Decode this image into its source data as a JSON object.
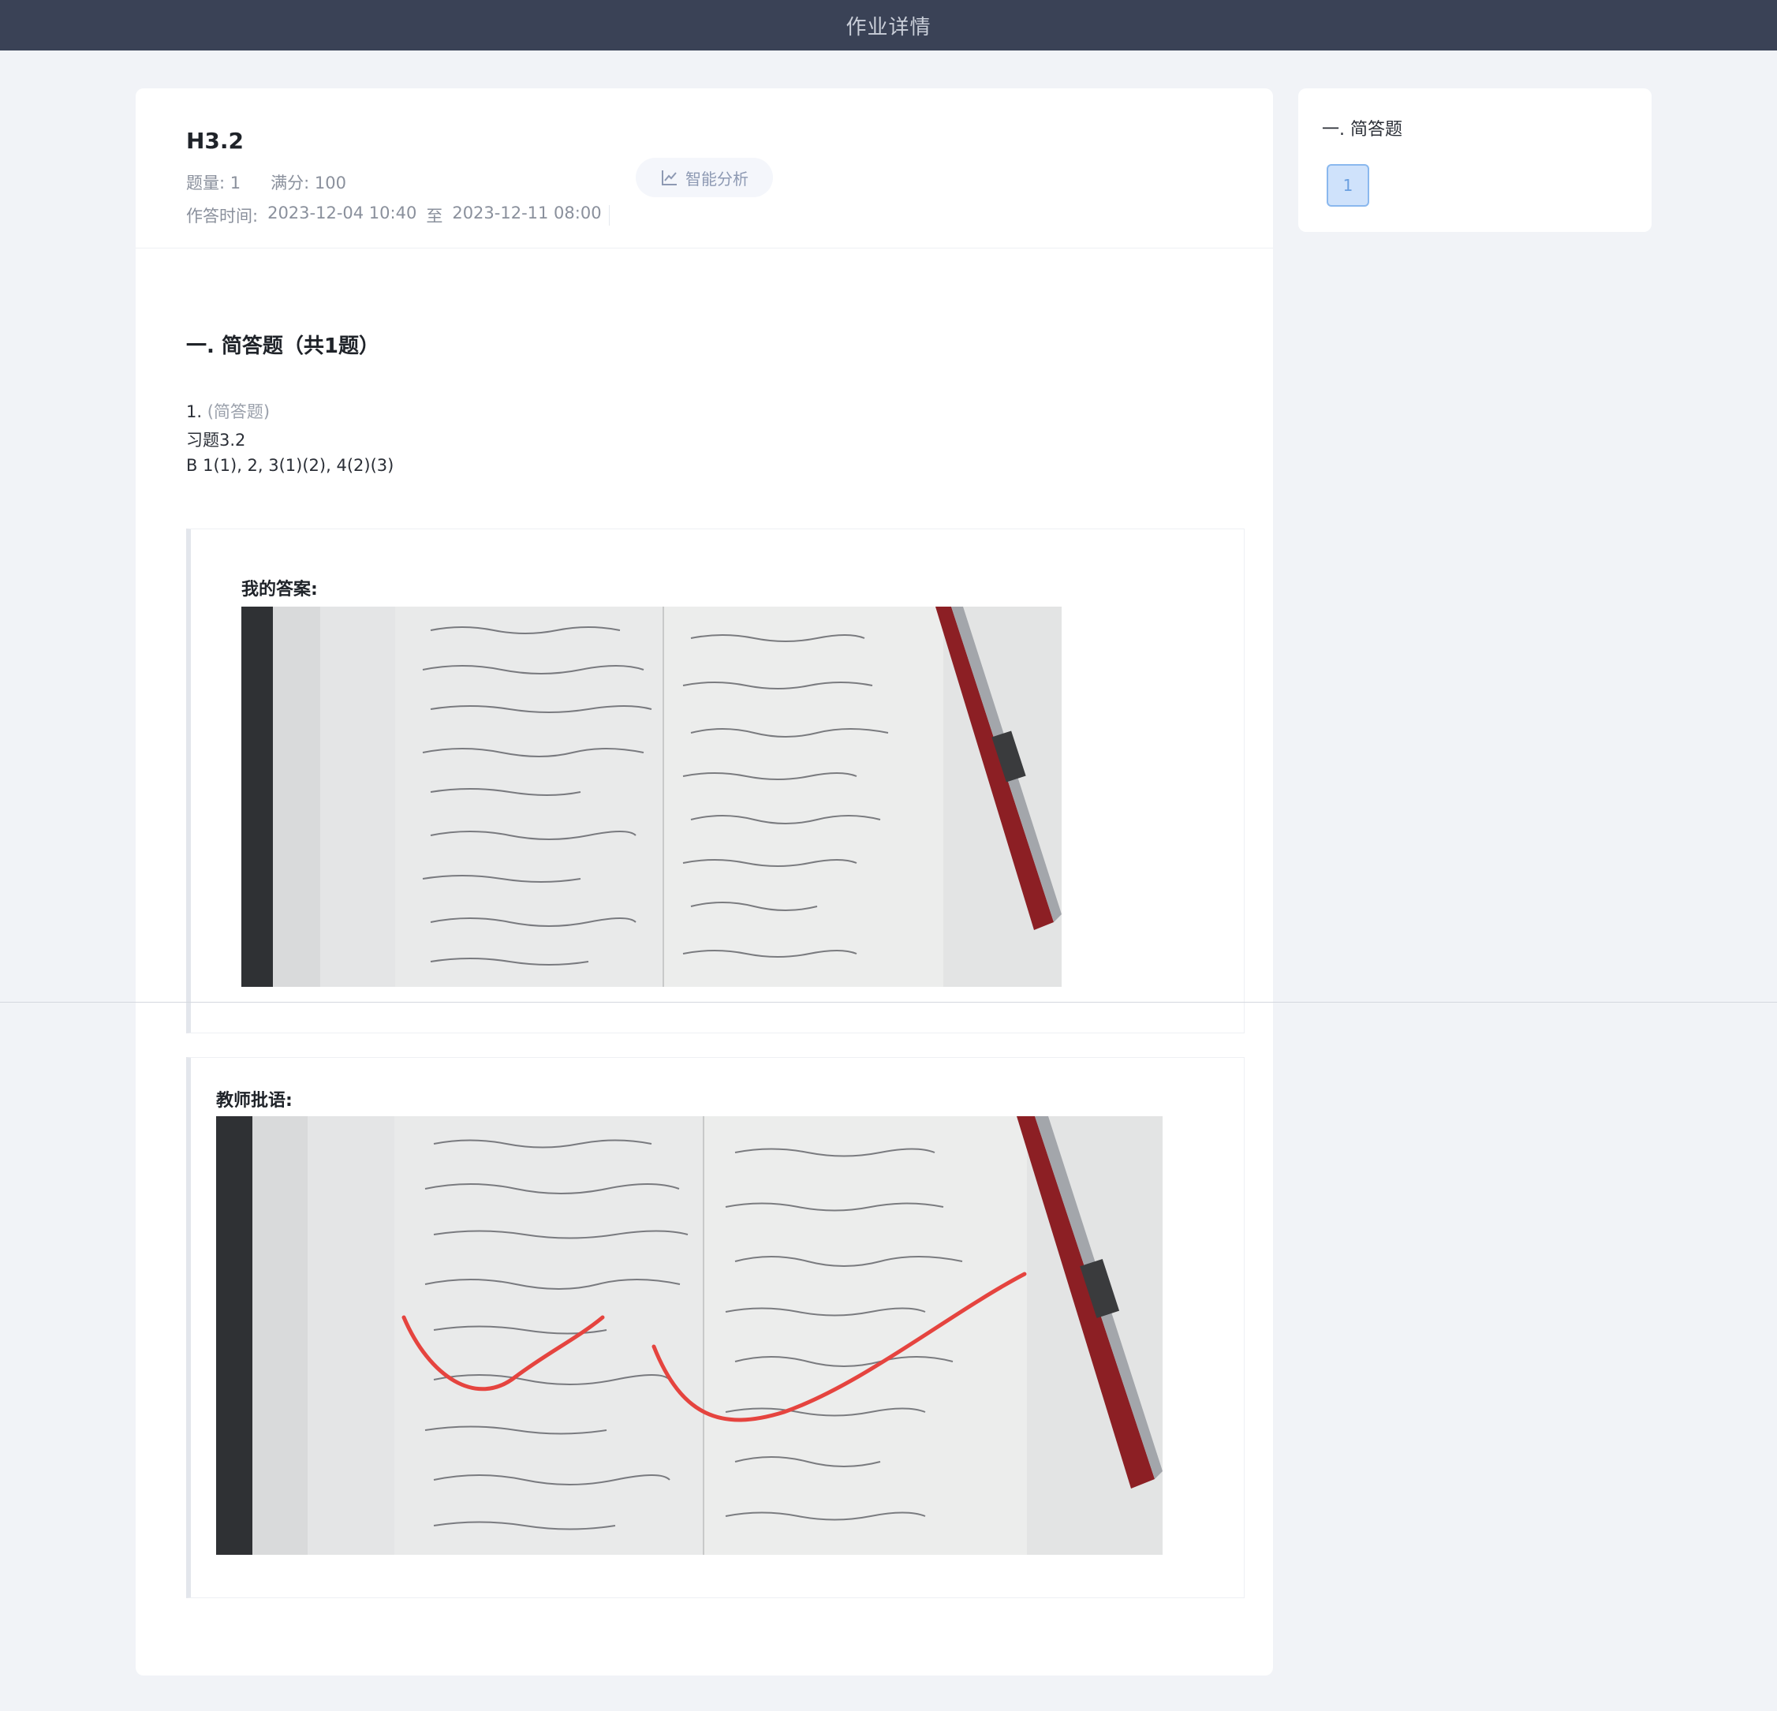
{
  "topbar": {
    "title": "作业详情"
  },
  "homework": {
    "title": "H3.2",
    "count": "题量: 1",
    "score": "满分: 100",
    "time_label": "作答时间:",
    "start": "2023-12-04 10:40",
    "to": "至",
    "end": "2023-12-11 08:00",
    "ai_button": "智能分析",
    "ai_icon": "line-chart-icon"
  },
  "section": {
    "title": "一. 简答题（共1题）"
  },
  "question": {
    "number": "1.",
    "type": "(简答题)",
    "line1": "习题3.2",
    "line2": "B  1(1), 2, 3(1)(2), 4(2)(3)"
  },
  "answer": {
    "label": "我的答案:"
  },
  "comment": {
    "label": "教师批语:"
  },
  "sidebar": {
    "section_title": "一. 简答题",
    "items": [
      {
        "label": "1"
      }
    ]
  },
  "colors": {
    "topbar_bg": "#3a4256",
    "page_bg": "#f1f3f7",
    "accent_blue": "#8ab8ee",
    "teacher_mark": "#e5443f"
  }
}
